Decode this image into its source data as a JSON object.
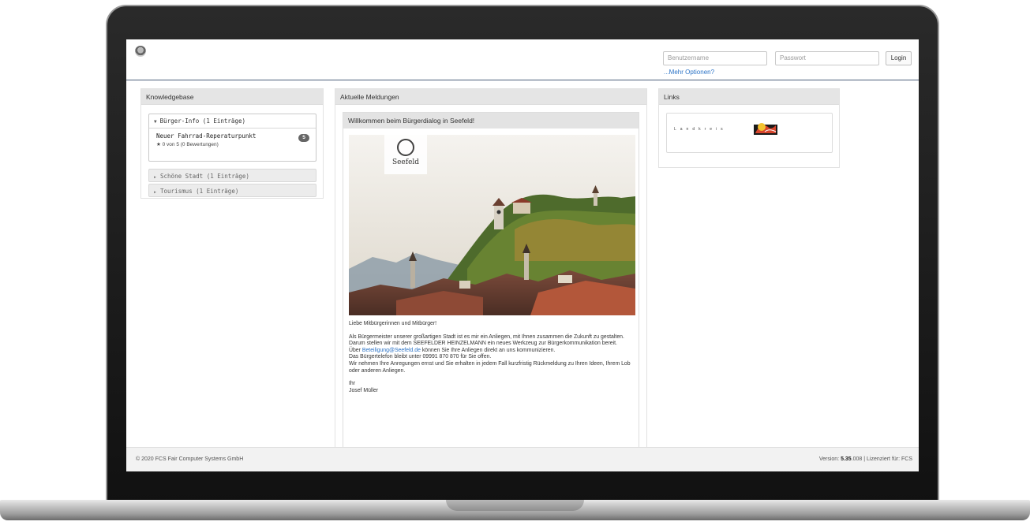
{
  "header": {
    "username_placeholder": "Benutzername",
    "password_placeholder": "Passwort",
    "login_label": "Login",
    "more_options": "...Mehr Optionen?"
  },
  "knowledgebase": {
    "title": "Knowledgebase",
    "open_category": "Bürger-Info (1 Einträge)",
    "item": {
      "title": "Neuer Fahrrad-Reperaturpunkt",
      "rating": "★ 0 von 5 (0 Bewertungen)",
      "badge": "5"
    },
    "closed_categories": [
      "Schöne Stadt (1 Einträge)",
      "Tourismus (1 Einträge)"
    ]
  },
  "news": {
    "title": "Aktuelle Meldungen",
    "item_title": "Willkommen beim Bürgerdialog in Seefeld!",
    "image_logo_text": "Seefeld",
    "greeting": "Liebe Mitbürgerinnen und Mitbürger!",
    "body_1": "Als Bürgermeister unserer großartigen Stadt ist es mir ein Anliegen, mit Ihnen zusammen die Zukunft zu gestalten. Darum stellen wir mit dem SEEFELDER HEINZELMANN ein neues Werkzeug zur Bürgerkommunikation bereit.",
    "body_2_pre": "Über ",
    "email": "Beteiligung@Seefeld.de",
    "body_2_post": " können Sie Ihre Anliegen direkt an uns kommunizieren.",
    "body_3": "Das Bürgertelefon bleibt unter 09991 870 870 für Sie offen.",
    "body_4": "Wir nehmen Ihre Anregungen ernst und Sie erhalten in jedem Fall kurzfristig Rückmeldung zu Ihren Ideen, Ihrem Lob oder anderen Anliegen.",
    "sign_1": "Ihr",
    "sign_2": "Josef Müller"
  },
  "links": {
    "title": "Links",
    "logo_text": "Landkreis"
  },
  "footer": {
    "copyright": "© 2020 FCS Fair Computer Systems GmbH",
    "version_label": "Version: ",
    "version_number": "5.35",
    "version_rest": ".008 | Lizenziert für: FCS"
  }
}
